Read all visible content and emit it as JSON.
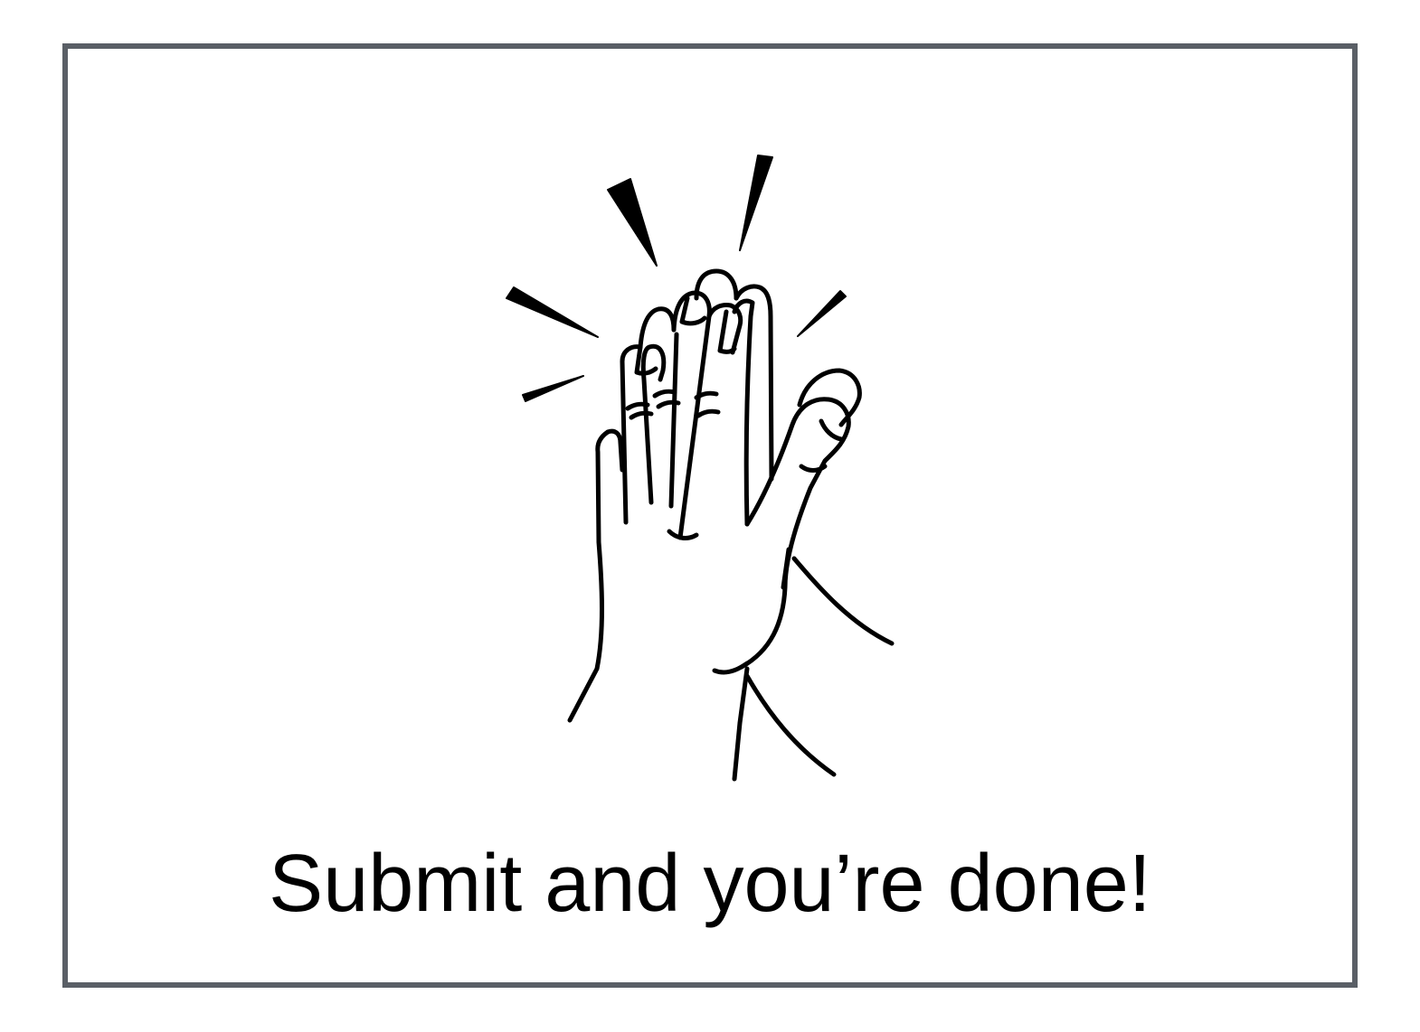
{
  "card": {
    "border_color": "#5a5f66",
    "background": "#ffffff"
  },
  "illustration": {
    "icon": "high-five-icon",
    "stroke_color": "#000000"
  },
  "caption": {
    "text": "Submit and you’re done!"
  }
}
